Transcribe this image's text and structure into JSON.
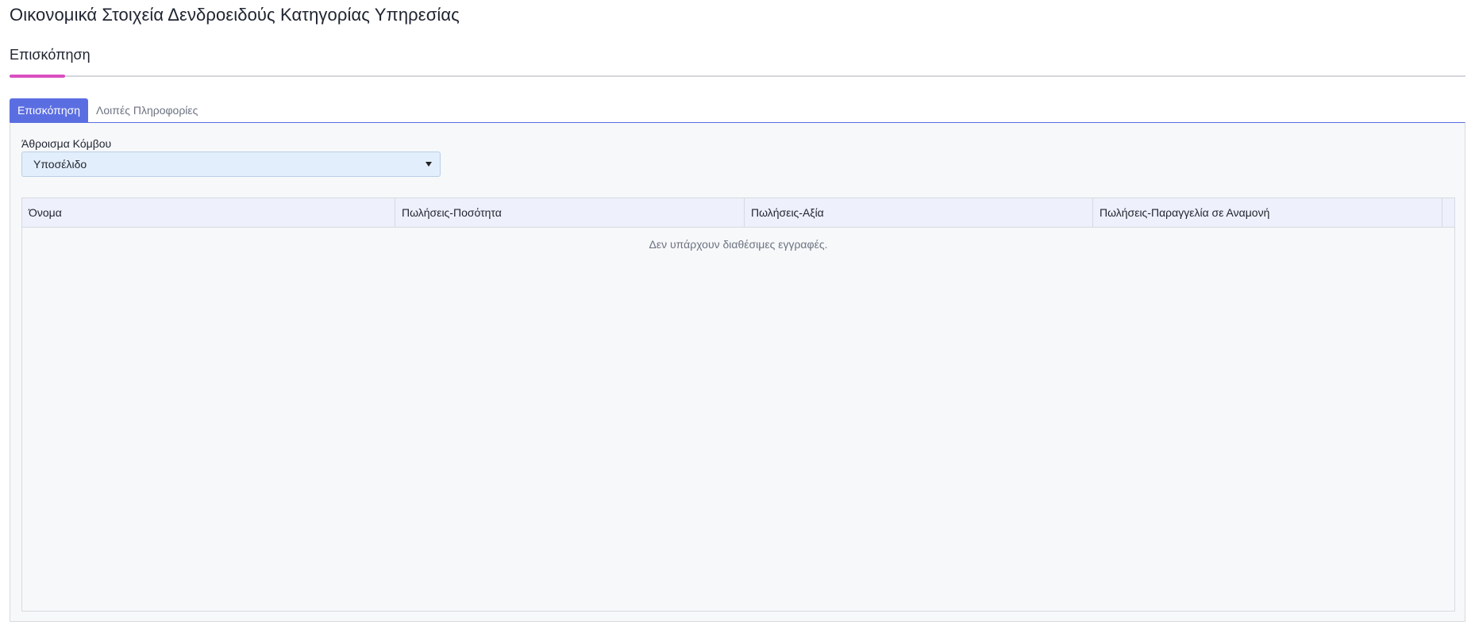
{
  "page": {
    "title": "Οικονομικά Στοιχεία Δενδροειδούς Κατηγορίας Υπηρεσίας"
  },
  "section": {
    "title": "Επισκόπηση"
  },
  "tabs": [
    {
      "label": "Επισκόπηση",
      "active": true
    },
    {
      "label": "Λοιπές Πληροφορίες",
      "active": false
    }
  ],
  "filter": {
    "label": "Άθροισμα Κόμβου",
    "selected": "Υποσέλιδο"
  },
  "grid": {
    "columns": [
      "Όνομα",
      "Πωλήσεις-Ποσότητα",
      "Πωλήσεις-Αξία",
      "Πωλήσεις-Παραγγελία σε Αναμονή"
    ],
    "empty_message": "Δεν υπάρχουν διαθέσιμες εγγραφές."
  },
  "colors": {
    "accent": "#5b6ee1",
    "section_underline": "#d94fc0",
    "select_bg": "#e2eefb",
    "grid_header_bg": "#eef0fb"
  }
}
